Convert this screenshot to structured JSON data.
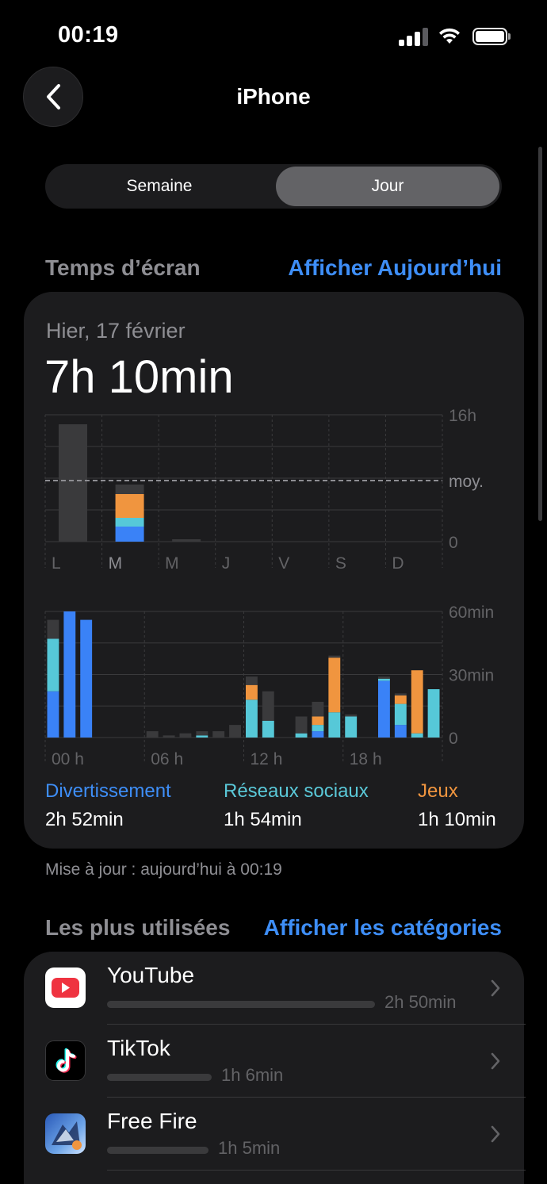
{
  "status_bar": {
    "time": "00:19"
  },
  "nav": {
    "title": "iPhone"
  },
  "segmented": {
    "options": [
      "Semaine",
      "Jour"
    ],
    "selected": "Jour"
  },
  "screen_time": {
    "section_title": "Temps d’écran",
    "section_link": "Afficher Aujourd’hui",
    "date_label": "Hier, 17 février",
    "total": "7h 10min",
    "updated": "Mise à jour : aujourd’hui à 00:19"
  },
  "weekly_chart": {
    "type": "bar",
    "categories": [
      "L",
      "M",
      "M",
      "J",
      "V",
      "S",
      "D"
    ],
    "y_labels": [
      "16h",
      "0"
    ],
    "average_label": "moy.",
    "ylim_hours": [
      0,
      16
    ],
    "average_hours": 7.7,
    "series": [
      {
        "name": "Divertissement",
        "color": "#3a82f7",
        "values": [
          0,
          1.9,
          0,
          0,
          0,
          0,
          0
        ]
      },
      {
        "name": "Réseaux sociaux",
        "color": "#56c8d8",
        "values": [
          0,
          1.1,
          0,
          0,
          0,
          0,
          0
        ]
      },
      {
        "name": "Jeux",
        "color": "#f0953f",
        "values": [
          0,
          3.0,
          0,
          0,
          0,
          0,
          0
        ]
      },
      {
        "name": "Autres",
        "color": "#3a3a3c",
        "values": [
          14.8,
          1.2,
          0.3,
          0,
          0,
          0,
          0
        ]
      }
    ]
  },
  "hourly_chart": {
    "type": "bar",
    "x_labels": [
      "00 h",
      "06 h",
      "12 h",
      "18 h"
    ],
    "y_labels": [
      "60min",
      "30min",
      "0"
    ],
    "ylim_minutes": [
      0,
      60
    ],
    "series": [
      {
        "name": "Divertissement",
        "color": "#3a82f7",
        "values": [
          22,
          60,
          56,
          0,
          0,
          0,
          0,
          0,
          0,
          0,
          0,
          0,
          0,
          0,
          0,
          0,
          3,
          0,
          0,
          0,
          27,
          6,
          0,
          0
        ]
      },
      {
        "name": "Réseaux sociaux",
        "color": "#56c8d8",
        "values": [
          25,
          0,
          0,
          0,
          0,
          0,
          0,
          0,
          0,
          1,
          0,
          0,
          18,
          8,
          0,
          2,
          3,
          12,
          10,
          0,
          1,
          10,
          2,
          23
        ]
      },
      {
        "name": "Jeux",
        "color": "#f0953f",
        "values": [
          0,
          0,
          0,
          0,
          0,
          0,
          0,
          0,
          0,
          0,
          0,
          0,
          7,
          0,
          0,
          0,
          4,
          26,
          0,
          0,
          0,
          4,
          30,
          0
        ]
      },
      {
        "name": "Autres",
        "color": "#3a3a3c",
        "values": [
          9,
          0,
          0,
          0,
          0,
          0,
          3,
          1,
          2,
          2,
          3,
          6,
          4,
          14,
          0,
          8,
          7,
          1,
          1,
          0,
          1,
          1,
          0,
          0
        ]
      }
    ]
  },
  "legend": [
    {
      "name": "Divertissement",
      "value": "2h 52min",
      "color": "#3e8ef7"
    },
    {
      "name": "Réseaux sociaux",
      "value": "1h 54min",
      "color": "#5ac8d8"
    },
    {
      "name": "Jeux",
      "value": "1h 10min",
      "color": "#f0953f"
    }
  ],
  "most_used": {
    "section_title": "Les plus utilisées",
    "section_link": "Afficher les catégories",
    "apps": [
      {
        "name": "YouTube",
        "time": "2h 50min",
        "share": 1.0,
        "icon": "youtube-icon"
      },
      {
        "name": "TikTok",
        "time": "1h 6min",
        "share": 0.39,
        "icon": "tiktok-icon"
      },
      {
        "name": "Free Fire",
        "time": "1h 5min",
        "share": 0.38,
        "icon": "free-fire-icon"
      }
    ]
  }
}
